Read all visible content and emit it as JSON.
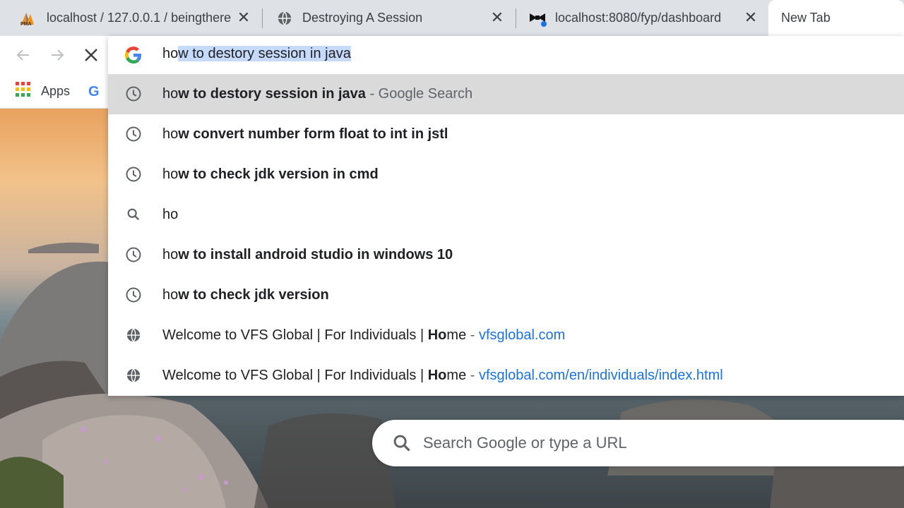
{
  "tabs": [
    {
      "title": "localhost / 127.0.0.1 / beingthere",
      "icon": "phpmyadmin-icon"
    },
    {
      "title": "Destroying A Session",
      "icon": "globe-icon"
    },
    {
      "title": "localhost:8080/fyp/dashboard",
      "icon": "bowtie-icon"
    },
    {
      "title": "New Tab",
      "icon": "none"
    }
  ],
  "tab_close_glyph": "✕",
  "bookmarks": {
    "apps_label": "Apps"
  },
  "omnibox": {
    "typed": "ho",
    "autocompleted": "w to destory session in java"
  },
  "suggestions": [
    {
      "icon": "history-icon",
      "typed": "ho",
      "rest": "w to destory session in java",
      "desc": " - Google Search",
      "url": ""
    },
    {
      "icon": "history-icon",
      "typed": "ho",
      "rest": "w convert number form float to int in jstl",
      "desc": "",
      "url": ""
    },
    {
      "icon": "history-icon",
      "typed": "ho",
      "rest": "w to check jdk version in cmd",
      "desc": "",
      "url": ""
    },
    {
      "icon": "search-icon",
      "typed": "ho",
      "rest": "",
      "desc": "",
      "url": ""
    },
    {
      "icon": "history-icon",
      "typed": "ho",
      "rest": "w to install android studio in windows 10",
      "desc": "",
      "url": ""
    },
    {
      "icon": "history-icon",
      "typed": "ho",
      "rest": "w to check jdk version",
      "desc": "",
      "url": ""
    },
    {
      "icon": "globe-icon",
      "pre": "Welcome to VFS Global | For Individuals | ",
      "bold": "Ho",
      "post": "me",
      "desc": " - ",
      "url": "vfsglobal.com"
    },
    {
      "icon": "globe-icon",
      "pre": "Welcome to VFS Global | For Individuals | ",
      "bold": "Ho",
      "post": "me",
      "desc": " - ",
      "url": "vfsglobal.com/en/individuals/index.html"
    }
  ],
  "ntp_search": {
    "placeholder": "Search Google or type a URL"
  },
  "colors": {
    "link": "#1a73e8",
    "selection": "#c6dafc",
    "selected_row": "#dadada"
  }
}
